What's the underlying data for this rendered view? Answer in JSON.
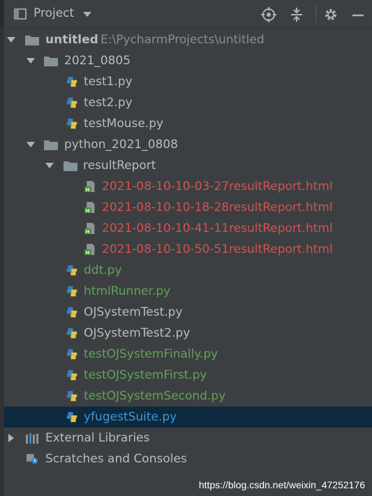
{
  "header": {
    "title": "Project",
    "icons": [
      "project-view-icon",
      "caret-down-icon",
      "locate-icon",
      "collapse-all-icon",
      "gear-icon",
      "minimize-icon"
    ]
  },
  "tree": {
    "root": {
      "label": "untitled",
      "path": "E:\\PycharmProjects\\untitled"
    },
    "folder1": {
      "label": "2021_0805"
    },
    "f1_files": [
      "test1.py",
      "test2.py",
      "testMouse.py"
    ],
    "folder2": {
      "label": "python_2021_0808"
    },
    "subfolder": {
      "label": "resultReport"
    },
    "reports": [
      "2021-08-10-10-03-27resultReport.html",
      "2021-08-10-10-18-28resultReport.html",
      "2021-08-10-10-41-11resultReport.html",
      "2021-08-10-10-50-51resultReport.html"
    ],
    "f2_files": [
      "ddt.py",
      "htmlRunner.py",
      "OJSystemTest.py",
      "OJSystemTest2.py",
      "testOJSystemFinally.py",
      "testOJSystemFirst.py",
      "testOJSystemSecond.py",
      "yfugestSuite.py"
    ],
    "external": "External Libraries",
    "scratches": "Scratches and Consoles"
  },
  "colors": {
    "background": "#3c3f41",
    "selected": "#0d293e",
    "unversioned_red": "#d25252",
    "added_green": "#62a25a",
    "modified_blue": "#3d97d8"
  },
  "watermark": "https://blog.csdn.net/weixin_47252176"
}
